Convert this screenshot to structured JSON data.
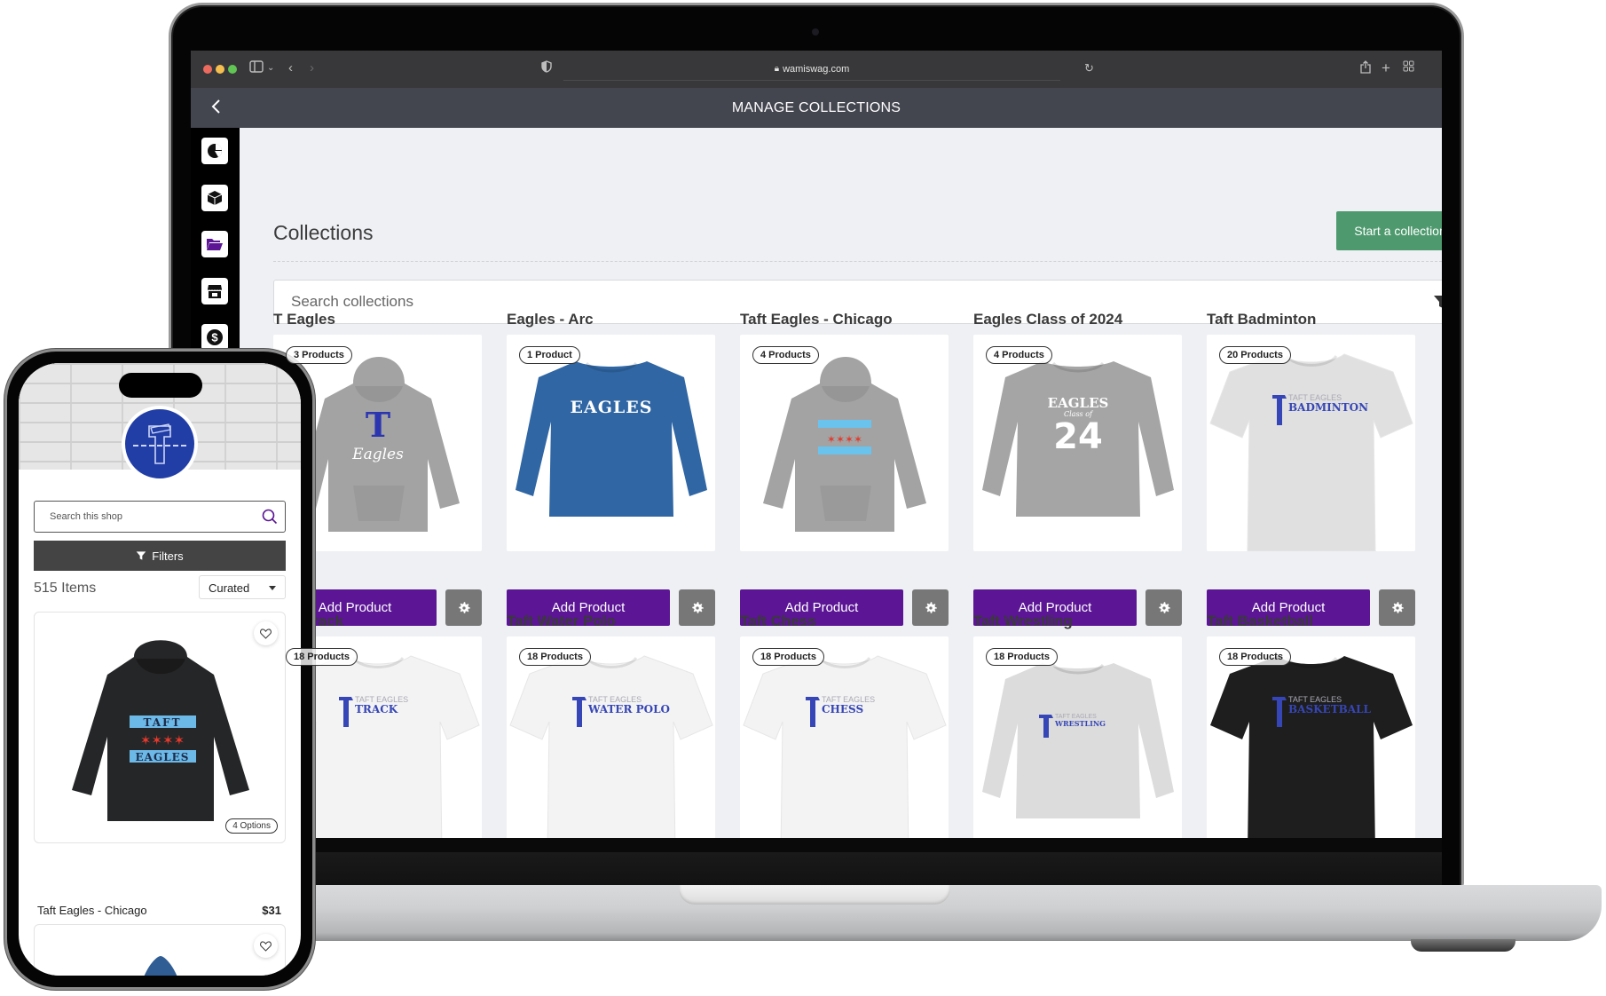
{
  "browser": {
    "url": "wamiswag.com",
    "traffic_lights": [
      "#ed6a5e",
      "#f5bf4f",
      "#61c554"
    ]
  },
  "app": {
    "header_title": "MANAGE COLLECTIONS",
    "back_icon": "chevron-left-icon",
    "sidebar_icons": [
      "pie-chart-icon",
      "box-icon",
      "folder-open-icon",
      "storefront-icon",
      "dollar-circle-icon"
    ],
    "page_title": "Collections",
    "start_button": "Start a collection",
    "search_placeholder": "Search collections",
    "filter_icon": "filter-icon",
    "add_product_label": "Add Product",
    "colors": {
      "primary": "#5b1595",
      "success": "#4e9a6e",
      "gear": "#777777",
      "header": "#43454f"
    },
    "collections": [
      {
        "title": "T Eagles",
        "badge": "3 Products",
        "garment": "hoodie",
        "color": "#a3a3a3",
        "print": "T Eagles"
      },
      {
        "title": "Eagles - Arc",
        "badge": "1 Product",
        "garment": "crewneck",
        "color": "#2f66a3",
        "print": "EAGLES"
      },
      {
        "title": "Taft Eagles - Chicago",
        "badge": "4 Products",
        "garment": "hoodie",
        "color": "#a3a3a3",
        "print": "Chicago"
      },
      {
        "title": "Eagles Class of 2024",
        "badge": "4 Products",
        "garment": "crewneck",
        "color": "#a5a5a5",
        "print": "EAGLES 24"
      },
      {
        "title": "Taft Badminton",
        "badge": "20 Products",
        "garment": "tshirt",
        "color": "#e0e0e0",
        "print": "BADMINTON"
      },
      {
        "title": "Taft Track",
        "badge": "18 Products",
        "garment": "tshirt",
        "color": "#f3f3f3",
        "print": "TRACK"
      },
      {
        "title": "Taft Water Polo",
        "badge": "18 Products",
        "garment": "tshirt",
        "color": "#f3f3f3",
        "print": "WATER POLO"
      },
      {
        "title": "Taft Chess",
        "badge": "18 Products",
        "garment": "tshirt",
        "color": "#f3f3f3",
        "print": "CHESS"
      },
      {
        "title": "Taft Wrestling",
        "badge": "18 Products",
        "garment": "crewneck",
        "color": "#dcdcdc",
        "print": "WRESTLING"
      },
      {
        "title": "Taft Basketball",
        "badge": "18 Products",
        "garment": "tshirt",
        "color": "#1e1e1e",
        "print": "BASKETBALL"
      }
    ]
  },
  "phone": {
    "search_placeholder": "Search this shop",
    "filters_label": "Filters",
    "item_count": "515 Items",
    "sort_selected": "Curated",
    "product": {
      "name": "Taft Eagles - Chicago",
      "price": "$31",
      "options": "4 Options"
    }
  }
}
